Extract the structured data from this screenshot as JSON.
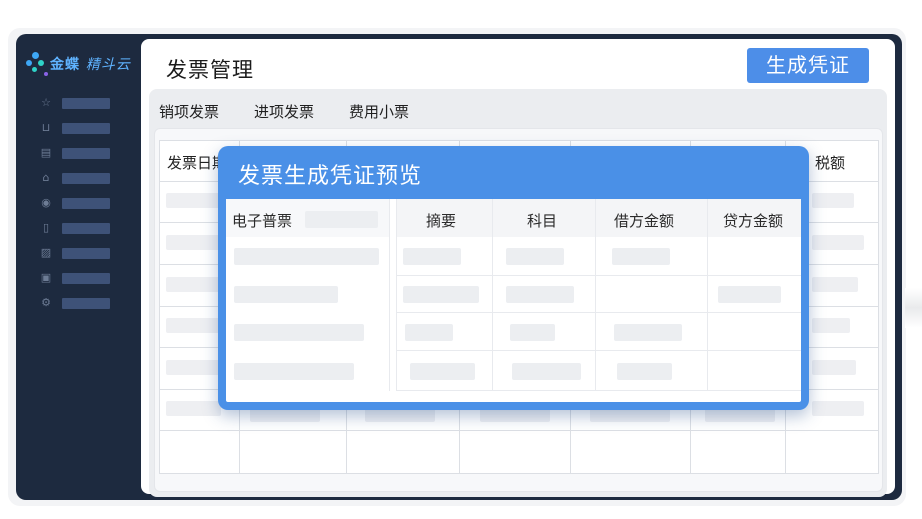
{
  "brand": {
    "name": "金蝶",
    "product": "精斗云"
  },
  "sidebar": {
    "items": [
      {
        "icon": "star-icon",
        "glyph": "☆"
      },
      {
        "icon": "cart-icon",
        "glyph": "⊔"
      },
      {
        "icon": "document-icon",
        "glyph": "▤"
      },
      {
        "icon": "home-icon",
        "glyph": "⌂"
      },
      {
        "icon": "coin-icon",
        "glyph": "◉"
      },
      {
        "icon": "file-icon",
        "glyph": "▯"
      },
      {
        "icon": "chart-icon",
        "glyph": "▨"
      },
      {
        "icon": "safe-icon",
        "glyph": "▣"
      },
      {
        "icon": "settings-icon",
        "glyph": "⚙"
      }
    ]
  },
  "header": {
    "title": "发票管理",
    "generate_button": "生成凭证"
  },
  "tabs": [
    "销项发票",
    "进项发票",
    "费用小票"
  ],
  "background_table": {
    "columns": [
      "发票日期",
      "税额"
    ]
  },
  "modal": {
    "title": "发票生成凭证预览",
    "left_header": "电子普票",
    "columns": [
      "摘要",
      "科目",
      "借方金额",
      "贷方金额"
    ]
  }
}
